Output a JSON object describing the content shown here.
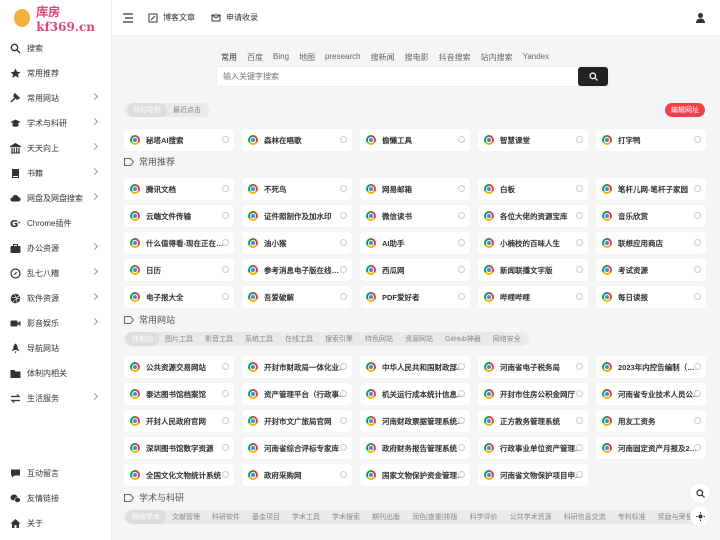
{
  "logo": {
    "text": "库房kf369.cn"
  },
  "sidebar": {
    "items": [
      {
        "label": "搜索",
        "icon": "search-icon",
        "chevron": false
      },
      {
        "label": "常用推荐",
        "icon": "star-icon",
        "chevron": false
      },
      {
        "label": "常用网站",
        "icon": "hammer-icon",
        "chevron": true
      },
      {
        "label": "学术与科研",
        "icon": "graduation-cap-icon",
        "chevron": true
      },
      {
        "label": "天天向上",
        "icon": "bank-icon",
        "chevron": true
      },
      {
        "label": "书籍",
        "icon": "book-icon",
        "chevron": true
      },
      {
        "label": "网盘及网盘搜索",
        "icon": "cloud-icon",
        "chevron": true
      },
      {
        "label": "Chrome插件",
        "icon": "google-icon",
        "chevron": false
      },
      {
        "label": "办公资源",
        "icon": "briefcase-icon",
        "chevron": true
      },
      {
        "label": "乱七八糟",
        "icon": "compass-icon",
        "chevron": true
      },
      {
        "label": "软件资源",
        "icon": "dribbble-icon",
        "chevron": true
      },
      {
        "label": "影音娱乐",
        "icon": "video-icon",
        "chevron": true
      },
      {
        "label": "导航网站",
        "icon": "rocket-icon",
        "chevron": false
      },
      {
        "label": "体制内相关",
        "icon": "folder-icon",
        "chevron": false
      },
      {
        "label": "生活服务",
        "icon": "exchange-icon",
        "chevron": true
      }
    ],
    "bottom": [
      {
        "label": "互动留言",
        "icon": "comment-icon"
      },
      {
        "label": "友情链接",
        "icon": "wechat-icon"
      },
      {
        "label": "关于",
        "icon": "home-icon"
      }
    ]
  },
  "topbar": {
    "post_label": "博客文章",
    "apply_label": "申请收录"
  },
  "search": {
    "tabs": [
      "常用",
      "百度",
      "Bing",
      "地图",
      "presearch",
      "搜新闻",
      "搜电影",
      "抖音搜索",
      "站内搜索",
      "Yandex"
    ],
    "placeholder": "输入关键字搜索"
  },
  "pills": [
    "我的导航",
    "最近点击"
  ],
  "edit_label": "编辑网址",
  "mynav": [
    "秘塔AI搜索",
    "森林在唱歌",
    "偷懒工具",
    "智慧课堂",
    "打字鸭"
  ],
  "sections": [
    {
      "title": "常用推荐",
      "tabs": [],
      "sites": [
        "腾讯文档",
        "不死鸟",
        "网易邮箱",
        "白板",
        "笔杆儿网-笔杆子家园",
        "云端文件传输",
        "证件照制作及加水印",
        "微信读书",
        "各位大佬的资源宝库",
        "音乐欣赏",
        "什么值得看-现在正在发...",
        "油小猴",
        "AI助手",
        "小楠枝的百味人生",
        "联想应用商店",
        "日历",
        "参考消息电子版在线阅读",
        "西瓜网",
        "新闻联播文字版",
        "考试资源",
        "电子报大全",
        "吾爱破解",
        "PDF爱好者",
        "哔哩哔哩",
        "每日读报"
      ]
    },
    {
      "title": "常用网站",
      "tabs": [
        "体制内",
        "图片工具",
        "影音工具",
        "系统工具",
        "在线工具",
        "搜索引擎",
        "特色网站",
        "资源网站",
        "GitHub神器",
        "网络安全"
      ],
      "sites": [
        "公共资源交易网站",
        "开封市财政局一体化业...",
        "中华人民共和国财政部...",
        "河南省电子税务局",
        "2023年内控告编制（河南）",
        "泰达图书馆档案馆",
        "资产管理平台（行政事...",
        "机关运行成本统计信息...",
        "开封市住房公积金网厅",
        "河南省专业技术人员公...",
        "开封人民政府官网",
        "开封市文广旅局官网",
        "河南财政票据管理系统...",
        "正方教务管理系统",
        "用友工资务",
        "深圳图书馆数字资源",
        "河南省综合评标专家库",
        "政府财务报告管理系统",
        "行政事业单位资产管理...",
        "河南固定资产月报及202...",
        "全国文化文物统计系统",
        "政府采购网",
        "国家文物保护资金管理...",
        "河南省文物保护项目申..."
      ]
    },
    {
      "title": "学术与科研",
      "tabs": [
        "网络学术",
        "文献管理",
        "科研软件",
        "基金项目",
        "学术工具",
        "学术搜索",
        "期刊出版",
        "润色|查重|排版",
        "科学评价",
        "公共学术资源",
        "科研信息交流",
        "专利标准",
        "奖励与荣誉"
      ],
      "sites": []
    }
  ]
}
